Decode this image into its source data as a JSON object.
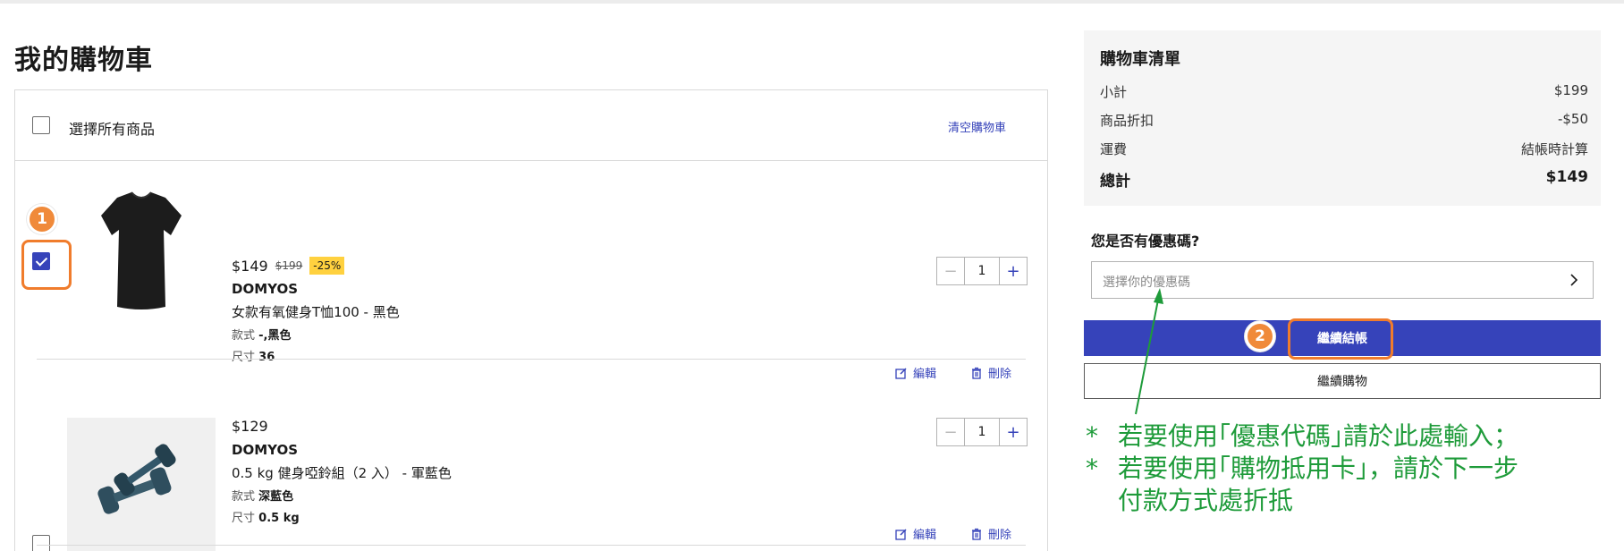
{
  "page": {
    "title": "我的購物車"
  },
  "cart": {
    "select_all_label": "選擇所有商品",
    "clear_cart_label": "清空購物車",
    "items": [
      {
        "price": "$149",
        "old_price": "$199",
        "discount": "-25%",
        "brand": "DOMYOS",
        "name": "女款有氧健身T恤100 - 黑色",
        "style_label": "款式",
        "style_value": "-,黑色",
        "size_label": "尺寸",
        "size_value": "36",
        "quantity": "1",
        "checked": true,
        "edit_label": "編輯",
        "delete_label": "刪除",
        "image_icon": "black-tshirt-image"
      },
      {
        "price": "$129",
        "brand": "DOMYOS",
        "name": "0.5 kg 健身啞鈴組（2 入） - 軍藍色",
        "style_label": "款式",
        "style_value": "深藍色",
        "size_label": "尺寸",
        "size_value": "0.5 kg",
        "quantity": "1",
        "checked": false,
        "edit_label": "編輯",
        "delete_label": "刪除",
        "image_icon": "dumbbell-set-image"
      }
    ]
  },
  "summary": {
    "title": "購物車清單",
    "rows": [
      {
        "label": "小計",
        "value": "$199"
      },
      {
        "label": "商品折扣",
        "value": "-$50"
      },
      {
        "label": "運費",
        "value": "結帳時計算"
      }
    ],
    "total_label": "總計",
    "total_value": "$149"
  },
  "coupon": {
    "question": "您是否有優惠碼?",
    "placeholder": "選擇你的優惠碼"
  },
  "buttons": {
    "checkout": "繼續結帳",
    "continue_shopping": "繼續購物"
  },
  "annotations": {
    "marker_1": "1",
    "marker_2": "2",
    "note_bullet": "*",
    "note_line1": "若要使用｢優惠代碼｣請於此處輸入；",
    "note_line2": "若要使用｢購物抵用卡｣，請於下一步",
    "note_line3": "付款方式處折抵"
  },
  "colors": {
    "accent": "#3643ba",
    "discount_badge": "#ffd13f",
    "annotation_orange": "#f08a3a",
    "annotation_green": "#1e9b3a"
  }
}
